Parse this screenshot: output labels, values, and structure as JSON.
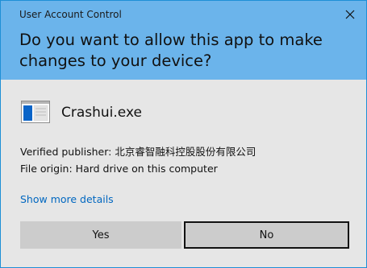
{
  "window": {
    "title": "User Account Control",
    "close_icon": "close-icon"
  },
  "header": {
    "question": "Do you want to allow this app to make changes to your device?"
  },
  "app": {
    "icon": "app-window-icon",
    "name": "Crashui.exe"
  },
  "details": {
    "publisher_line": "Verified publisher: 北京睿智融科控股股份有限公司",
    "origin_line": "File origin: Hard drive on this computer"
  },
  "link": {
    "show_more": "Show more details"
  },
  "buttons": {
    "yes": "Yes",
    "no": "No"
  },
  "colors": {
    "header_bg": "#6bb4eb",
    "body_bg": "#e6e6e6",
    "link": "#0067c0",
    "button_bg": "#cccccc"
  }
}
